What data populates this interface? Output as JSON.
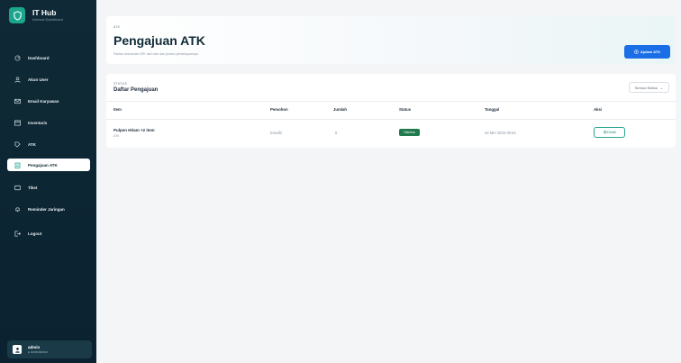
{
  "brand": {
    "title": "IT Hub",
    "subtitle": "Internal Dashboard"
  },
  "sidebar": {
    "items": [
      {
        "label": "Dashboard",
        "icon": "dashboard-icon"
      },
      {
        "label": "Akun User",
        "icon": "user-icon"
      },
      {
        "label": "Email Karyawan",
        "icon": "mail-icon"
      },
      {
        "label": "Inventaris",
        "icon": "box-icon"
      },
      {
        "label": "ATK",
        "icon": "tag-icon"
      },
      {
        "label": "Pengajuan ATK",
        "icon": "clipboard-icon",
        "active": true
      },
      {
        "label": "Tiket",
        "icon": "ticket-icon"
      },
      {
        "label": "Reminder Jaringan",
        "icon": "bell-icon"
      },
      {
        "label": "Logout",
        "icon": "logout-icon"
      }
    ]
  },
  "user": {
    "name": "admin",
    "role": "● Administrator"
  },
  "header": {
    "breadcrumb": "ATK",
    "title": "Pengajuan ATK",
    "subtitle": "Pantau kebutuhan ATK dari user dan proses persetujuannya.",
    "action_label": "Ajukan ATK"
  },
  "list": {
    "kicker": "STATUS",
    "title": "Daftar Pengajuan",
    "filter": "Semua Status",
    "columns": [
      "Item",
      "Pemohon",
      "Jumlah",
      "Status",
      "Tanggal",
      "Aksi"
    ],
    "rows": [
      {
        "item": "Pulpen Hitam +2 item",
        "category": "ATK",
        "requester": "Emathi",
        "qty": "9",
        "status": "Diterima",
        "date": "26 Mei 2026 09:54",
        "action": "Detail"
      }
    ]
  },
  "colors": {
    "sidebar": "#0f2a36",
    "primary": "#1a6fe6",
    "status_badge": "#1f7a4c",
    "accent": "#1aa58c"
  }
}
